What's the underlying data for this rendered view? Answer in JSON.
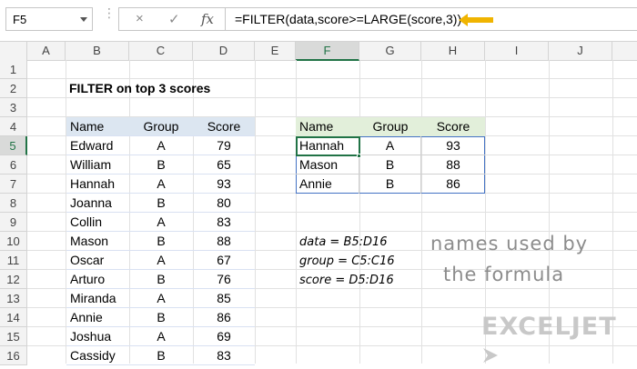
{
  "formula_bar": {
    "name_box": "F5",
    "cancel_icon": "×",
    "enter_icon": "✓",
    "fx_label": "fx",
    "formula": "=FILTER(data,score>=LARGE(score,3))"
  },
  "columns": [
    "A",
    "B",
    "C",
    "D",
    "E",
    "F",
    "G",
    "H",
    "I",
    "J"
  ],
  "rows": [
    "1",
    "2",
    "3",
    "4",
    "5",
    "6",
    "7",
    "8",
    "9",
    "10",
    "11",
    "12",
    "13",
    "14",
    "15",
    "16"
  ],
  "selected": {
    "column": "F",
    "row": "5"
  },
  "sheet_title": "FILTER on top 3 scores",
  "data_table": {
    "headers": [
      "Name",
      "Group",
      "Score"
    ],
    "rows": [
      [
        "Edward",
        "A",
        "79"
      ],
      [
        "William",
        "B",
        "65"
      ],
      [
        "Hannah",
        "A",
        "93"
      ],
      [
        "Joanna",
        "B",
        "80"
      ],
      [
        "Collin",
        "A",
        "83"
      ],
      [
        "Mason",
        "B",
        "88"
      ],
      [
        "Oscar",
        "A",
        "67"
      ],
      [
        "Arturo",
        "B",
        "76"
      ],
      [
        "Miranda",
        "A",
        "85"
      ],
      [
        "Annie",
        "B",
        "86"
      ],
      [
        "Joshua",
        "A",
        "69"
      ],
      [
        "Cassidy",
        "B",
        "83"
      ]
    ]
  },
  "result_table": {
    "headers": [
      "Name",
      "Group",
      "Score"
    ],
    "rows": [
      [
        "Hannah",
        "A",
        "93"
      ],
      [
        "Mason",
        "B",
        "88"
      ],
      [
        "Annie",
        "B",
        "86"
      ]
    ]
  },
  "named_ranges": [
    "data = B5:D16",
    "group = C5:C16",
    "score = D5:D16"
  ],
  "annotation": {
    "line1": "names used by",
    "line2": "the formula"
  },
  "logo": "EXCELJET",
  "colors": {
    "accent": "#217346",
    "arrow": "#f0b400",
    "table_header": "#dce6f1",
    "result_header": "#e2efda",
    "result_border": "#4472c4"
  }
}
